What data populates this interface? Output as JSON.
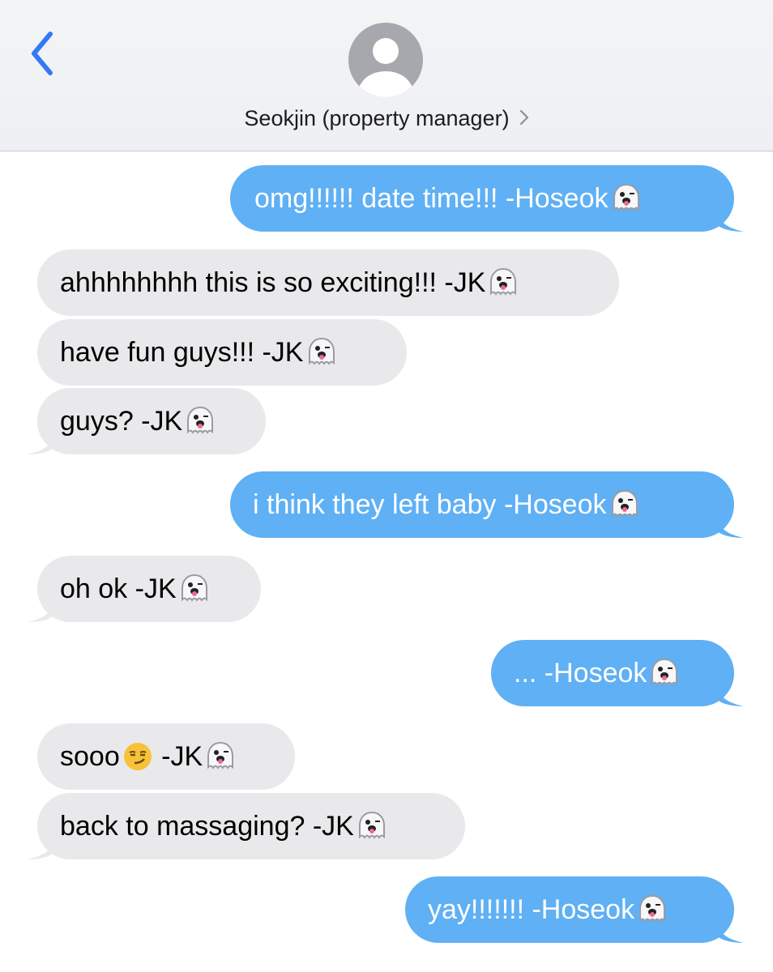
{
  "header": {
    "contact_name": "Seokjin (property manager)",
    "back_icon": "chevron-left-icon",
    "avatar_icon": "person-silhouette-icon",
    "detail_icon": "chevron-right-icon"
  },
  "colors": {
    "outgoing_bubble": "#5fb0f4",
    "incoming_bubble": "#e9e9eb",
    "accent": "#3478f6"
  },
  "messages": [
    {
      "direction": "outgoing",
      "text": "omg!!!!!! date time!!! -Hoseok",
      "emoji": "ghost"
    },
    {
      "direction": "incoming",
      "text": "ahhhhhhhh this is so exciting!!! -JK",
      "emoji": "ghost"
    },
    {
      "direction": "incoming",
      "text": "have fun guys!!! -JK",
      "emoji": "ghost"
    },
    {
      "direction": "incoming",
      "text": "guys? -JK",
      "emoji": "ghost"
    },
    {
      "direction": "outgoing",
      "text": "i think they left baby -Hoseok",
      "emoji": "ghost"
    },
    {
      "direction": "incoming",
      "text": "oh ok -JK",
      "emoji": "ghost"
    },
    {
      "direction": "outgoing",
      "text": "... -Hoseok",
      "emoji": "ghost"
    },
    {
      "direction": "incoming",
      "text_before": "sooo",
      "inline_emoji": "smirking-face",
      "text": " -JK",
      "emoji": "ghost"
    },
    {
      "direction": "incoming",
      "text": "back to massaging? -JK",
      "emoji": "ghost"
    },
    {
      "direction": "outgoing",
      "text": "yay!!!!!!! -Hoseok",
      "emoji": "ghost"
    }
  ]
}
